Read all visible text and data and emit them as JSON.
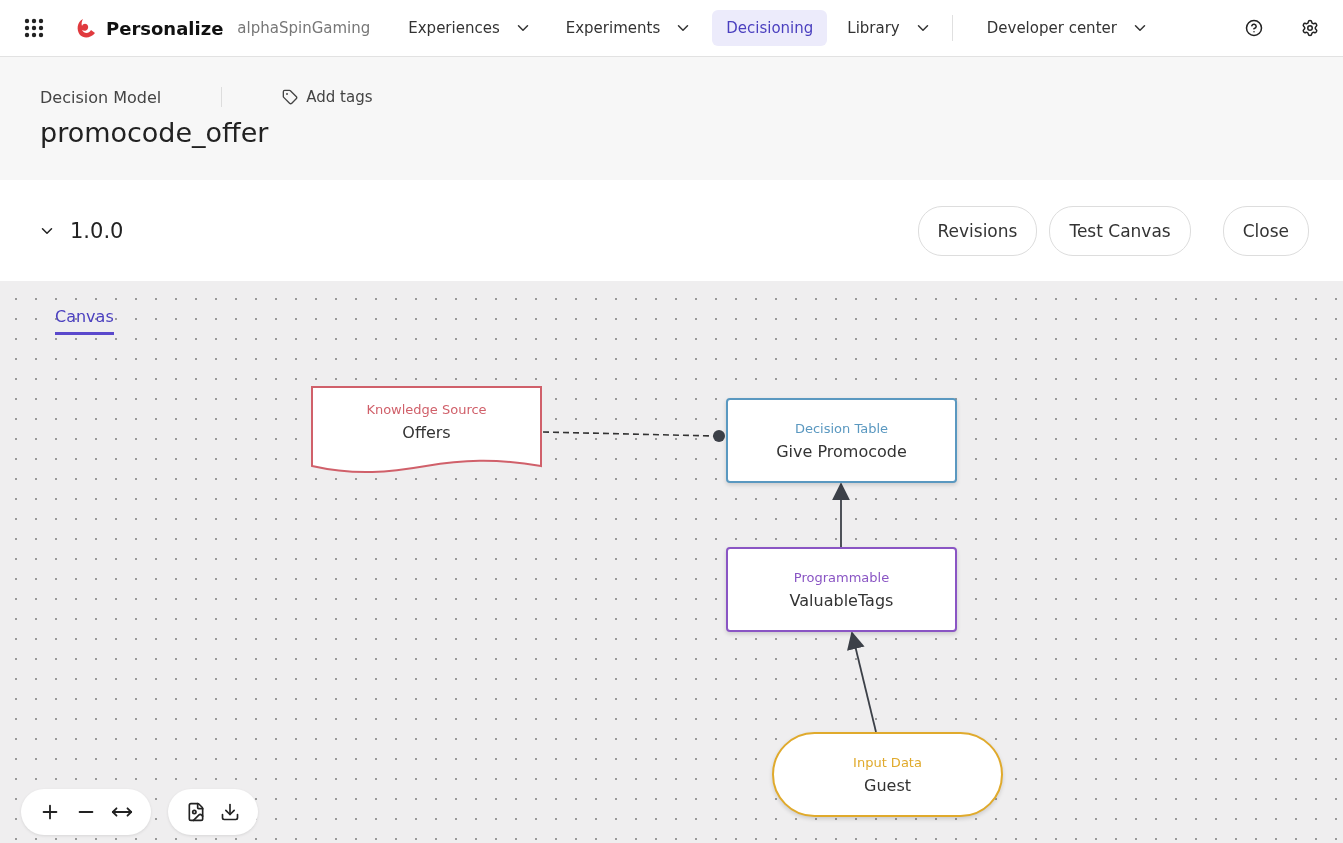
{
  "topbar": {
    "product": "Personalize",
    "workspace": "alphaSpinGaming",
    "nav": [
      {
        "label": "Experiences",
        "selected": false,
        "dropdown": true
      },
      {
        "label": "Experiments",
        "selected": false,
        "dropdown": true
      },
      {
        "label": "Decisioning",
        "selected": true,
        "dropdown": false
      },
      {
        "label": "Library",
        "selected": false,
        "dropdown": true
      },
      {
        "label": "Developer center",
        "selected": false,
        "dropdown": true
      }
    ]
  },
  "header": {
    "type": "Decision Model",
    "add_tags": "Add tags",
    "name": "promocode_offer"
  },
  "version": {
    "label": "1.0.0",
    "expanded": true,
    "buttons": [
      "Revisions",
      "Test Canvas",
      "Close"
    ]
  },
  "tabs": [
    {
      "label": "Canvas",
      "selected": true
    }
  ],
  "nodes": [
    {
      "kind": "knowledge_source",
      "type": "Knowledge Source",
      "name": "Offers",
      "color": "#d0606a"
    },
    {
      "kind": "decision_table",
      "type": "Decision Table",
      "name": "Give Promocode",
      "color": "#5a98c0"
    },
    {
      "kind": "programmable",
      "type": "Programmable",
      "name": "ValuableTags",
      "color": "#8a55c4"
    },
    {
      "kind": "input_data",
      "type": "Input Data",
      "name": "Guest",
      "color": "#e0aa2c"
    }
  ]
}
